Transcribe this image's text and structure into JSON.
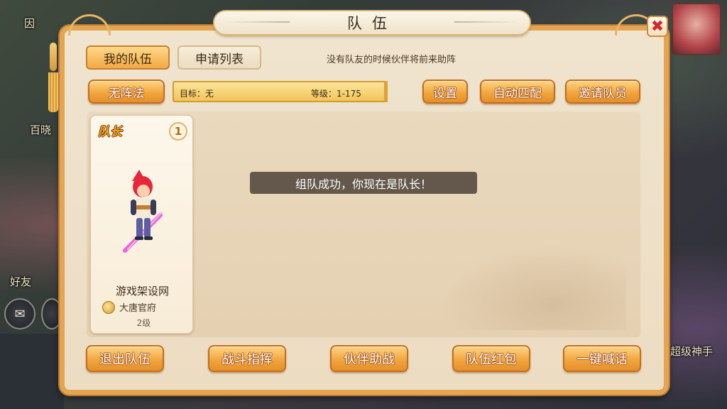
{
  "background": {
    "labels": [
      "因",
      "百晓",
      "好友",
      "超级神手"
    ]
  },
  "dialog": {
    "title": "队伍",
    "close_icon": "close-icon"
  },
  "tabs": {
    "my_team": "我的队伍",
    "apply_list": "申请列表"
  },
  "hint": "没有队友的时候伙伴将前来助阵",
  "formation_button": "无阵法",
  "target": {
    "goal": "目标：无",
    "level": "等级：1-175"
  },
  "toolbar": {
    "settings": "设置",
    "auto_match": "自动匹配",
    "invite": "邀请队员"
  },
  "member": {
    "role": "队长",
    "slot": "1",
    "name": "游戏架设网",
    "sect": "大唐官府",
    "level": "2级"
  },
  "toast": "组队成功，你现在是队长！",
  "actions": {
    "leave": "退出队伍",
    "battle_command": "战斗指挥",
    "partner_assist": "伙伴助战",
    "red_packet": "队伍红包",
    "shout": "一键喊话"
  },
  "colors": {
    "accent_orange": "#f0a33c",
    "panel_bg": "#ecdcc2",
    "close_red": "#d7262a"
  }
}
